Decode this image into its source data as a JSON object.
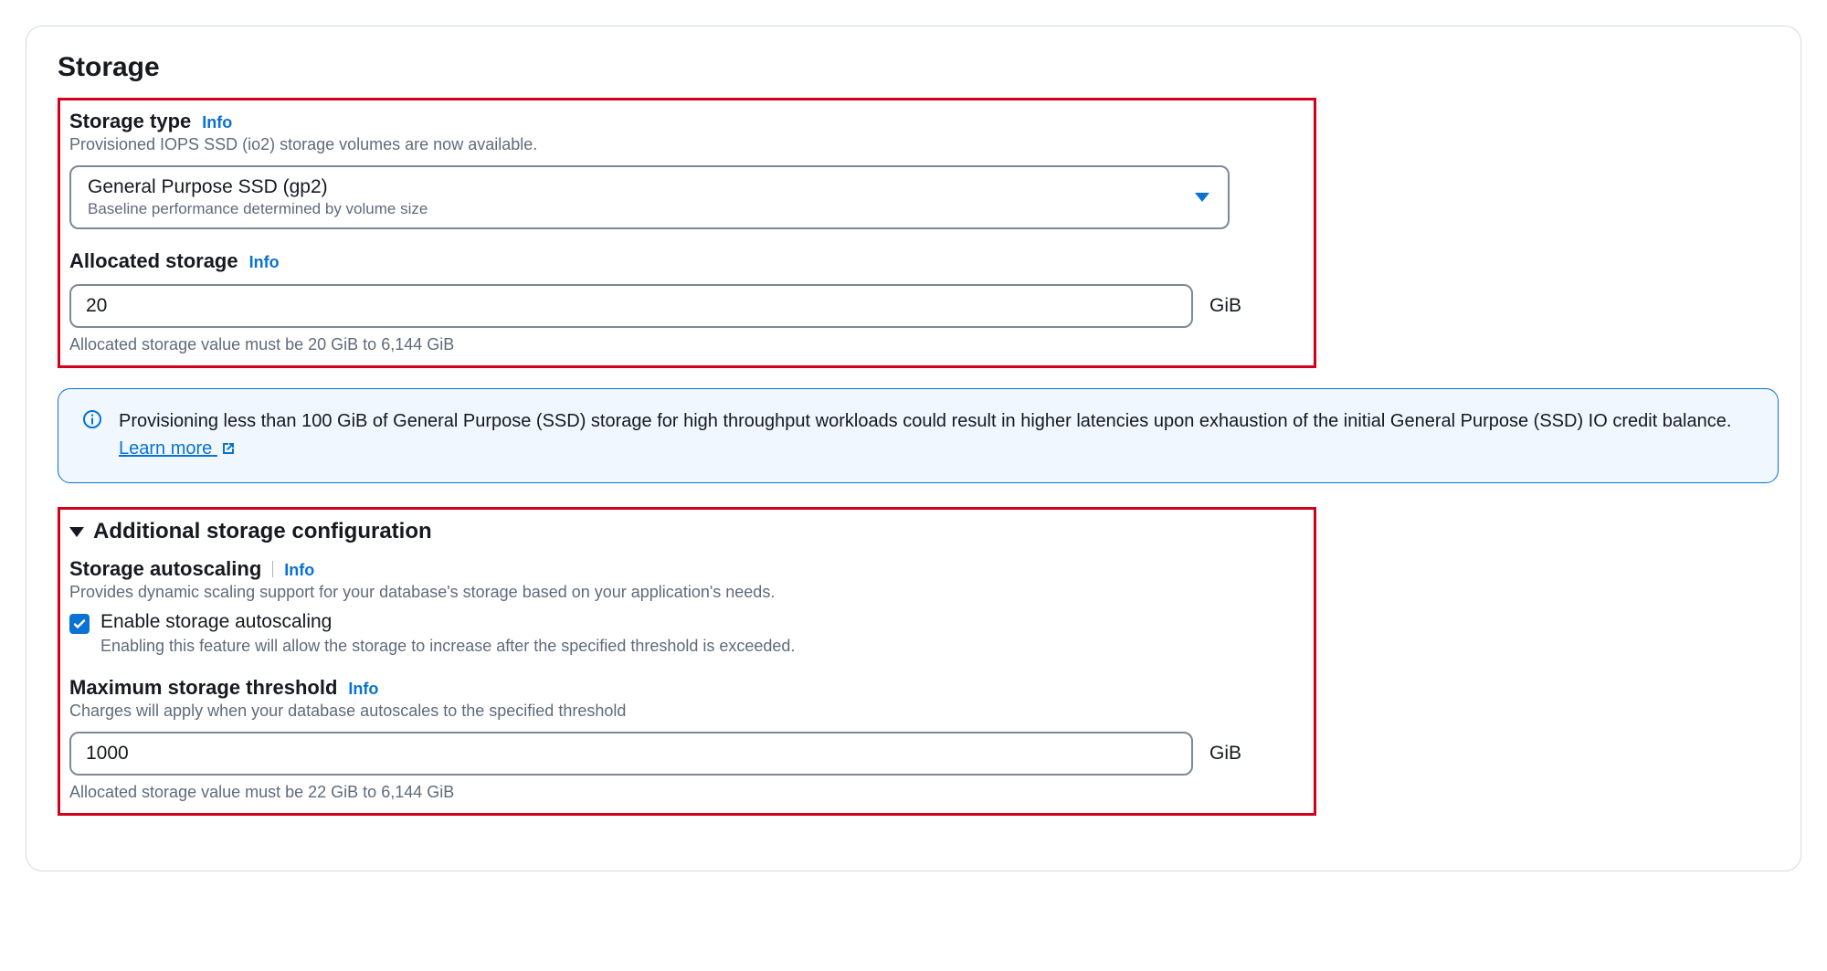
{
  "section": {
    "title": "Storage"
  },
  "storageType": {
    "label": "Storage type",
    "infoLabel": "Info",
    "helper": "Provisioned IOPS SSD (io2) storage volumes are now available.",
    "selected": {
      "main": "General Purpose SSD (gp2)",
      "sub": "Baseline performance determined by volume size"
    }
  },
  "allocatedStorage": {
    "label": "Allocated storage",
    "infoLabel": "Info",
    "value": "20",
    "unit": "GiB",
    "constraint": "Allocated storage value must be 20 GiB to 6,144 GiB"
  },
  "alert": {
    "text": "Provisioning less than 100 GiB of General Purpose (SSD) storage for high throughput workloads could result in higher latencies upon exhaustion of the initial General Purpose (SSD) IO credit balance. ",
    "linkLabel": "Learn more"
  },
  "additional": {
    "title": "Additional storage configuration",
    "autoscaling": {
      "label": "Storage autoscaling",
      "infoLabel": "Info",
      "helper": "Provides dynamic scaling support for your database's storage based on your application's needs.",
      "checkboxLabel": "Enable storage autoscaling",
      "checkboxDesc": "Enabling this feature will allow the storage to increase after the specified threshold is exceeded.",
      "checked": true
    },
    "maxThreshold": {
      "label": "Maximum storage threshold",
      "infoLabel": "Info",
      "helper": "Charges will apply when your database autoscales to the specified threshold",
      "value": "1000",
      "unit": "GiB",
      "constraint": "Allocated storage value must be 22 GiB to 6,144 GiB"
    }
  }
}
